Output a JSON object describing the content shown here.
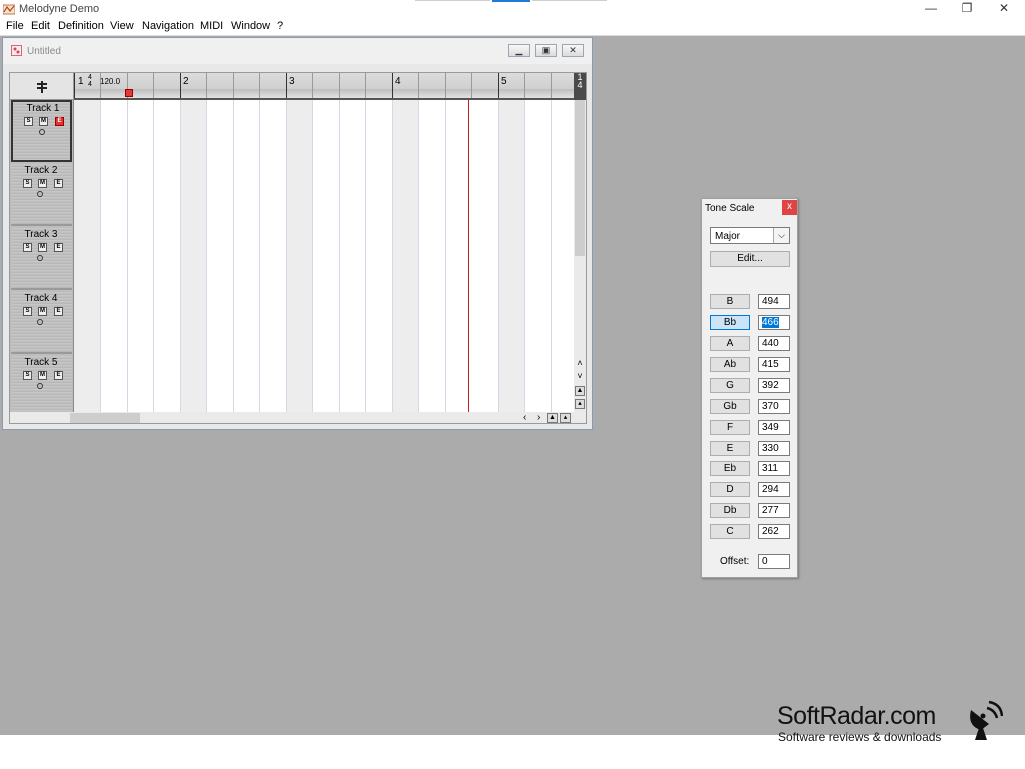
{
  "app": {
    "title": "Melodyne Demo"
  },
  "menu": [
    "File",
    "Edit",
    "Definition",
    "View",
    "Navigation",
    "MIDI",
    "Window",
    "?"
  ],
  "window_controls": {
    "minimize": "—",
    "restore": "❐",
    "close": "✕"
  },
  "document": {
    "title": "Untitled",
    "ruler": {
      "bars": [
        "1",
        "2",
        "3",
        "4",
        "5"
      ],
      "tempo": "120.0",
      "time_signature": {
        "top": "4",
        "bottom": "4"
      },
      "right_label_top": "1",
      "right_label_bottom": "4"
    },
    "tracks": [
      {
        "name": "Track 1",
        "solo": "S",
        "mute": "M",
        "edit": "E",
        "edit_active": true
      },
      {
        "name": "Track 2",
        "solo": "S",
        "mute": "M",
        "edit": "E",
        "edit_active": false
      },
      {
        "name": "Track 3",
        "solo": "S",
        "mute": "M",
        "edit": "E",
        "edit_active": false
      },
      {
        "name": "Track 4",
        "solo": "S",
        "mute": "M",
        "edit": "E",
        "edit_active": false
      },
      {
        "name": "Track 5",
        "solo": "S",
        "mute": "M",
        "edit": "E",
        "edit_active": false
      }
    ]
  },
  "tone_scale": {
    "title": "Tone Scale",
    "close": "x",
    "scale": "Major",
    "edit_label": "Edit...",
    "notes": [
      {
        "name": "B",
        "freq": "494"
      },
      {
        "name": "Bb",
        "freq": "466",
        "selected": true
      },
      {
        "name": "A",
        "freq": "440"
      },
      {
        "name": "Ab",
        "freq": "415"
      },
      {
        "name": "G",
        "freq": "392"
      },
      {
        "name": "Gb",
        "freq": "370"
      },
      {
        "name": "F",
        "freq": "349"
      },
      {
        "name": "E",
        "freq": "330"
      },
      {
        "name": "Eb",
        "freq": "311"
      },
      {
        "name": "D",
        "freq": "294"
      },
      {
        "name": "Db",
        "freq": "277"
      },
      {
        "name": "C",
        "freq": "262"
      }
    ],
    "offset_label": "Offset:",
    "offset_value": "0"
  },
  "watermark": {
    "main": "SoftRadar.com",
    "sub": "Software reviews & downloads"
  },
  "colors": {
    "playhead": "#c41e1e",
    "edit_active": "#e83030",
    "selection": "#0078d7",
    "workspace": "#ababab"
  }
}
